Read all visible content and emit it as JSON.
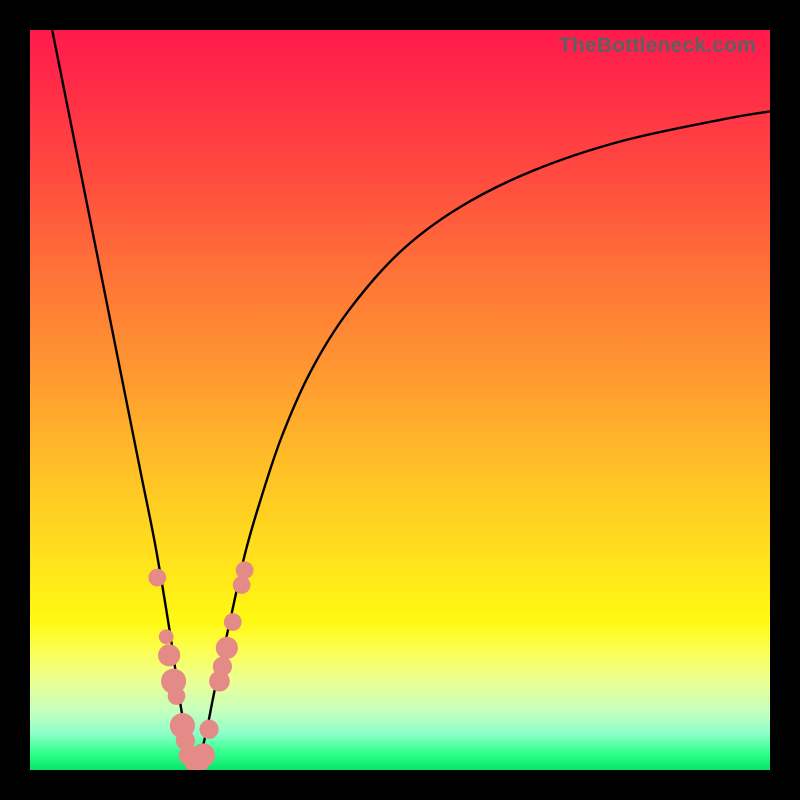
{
  "watermark": "TheBottleneck.com",
  "colors": {
    "frame": "#000000",
    "curve": "#000000",
    "bead": "#e58b87",
    "gradient_top": "#ff1a4d",
    "gradient_bottom": "#07e46a"
  },
  "chart_data": {
    "type": "line",
    "title": "",
    "xlabel": "",
    "ylabel": "",
    "xlim": [
      0,
      100
    ],
    "ylim": [
      0,
      100
    ],
    "note": "No axes/ticks shown; x and y are normalized 0–100 across the plot area. Curve is a V-shaped bottleneck profile with minimum near x≈22.",
    "series": [
      {
        "name": "bottleneck-curve",
        "x": [
          3,
          5,
          7,
          9,
          11,
          13,
          15,
          17,
          19,
          20,
          21,
          22,
          23,
          24,
          25,
          27,
          29,
          31,
          34,
          38,
          43,
          50,
          58,
          68,
          80,
          94,
          100
        ],
        "y": [
          100,
          90,
          80,
          70,
          60,
          50,
          40,
          30,
          18,
          11,
          5,
          1,
          2,
          6,
          11,
          20,
          29,
          36,
          45,
          54,
          62,
          70,
          76,
          81,
          85,
          88,
          89
        ]
      }
    ],
    "beads": {
      "name": "highlight-points",
      "points": [
        {
          "x": 17.2,
          "y": 26.0,
          "r": 1.2
        },
        {
          "x": 18.4,
          "y": 18.0,
          "r": 1.0
        },
        {
          "x": 18.8,
          "y": 15.5,
          "r": 1.5
        },
        {
          "x": 19.4,
          "y": 12.0,
          "r": 1.7
        },
        {
          "x": 19.8,
          "y": 10.0,
          "r": 1.2
        },
        {
          "x": 20.6,
          "y": 6.0,
          "r": 1.7
        },
        {
          "x": 21.0,
          "y": 4.0,
          "r": 1.3
        },
        {
          "x": 21.5,
          "y": 2.0,
          "r": 1.4
        },
        {
          "x": 22.2,
          "y": 1.0,
          "r": 1.3
        },
        {
          "x": 22.8,
          "y": 1.2,
          "r": 1.5
        },
        {
          "x": 23.4,
          "y": 2.0,
          "r": 1.6
        },
        {
          "x": 24.2,
          "y": 5.5,
          "r": 1.3
        },
        {
          "x": 25.6,
          "y": 12.0,
          "r": 1.4
        },
        {
          "x": 26.0,
          "y": 14.0,
          "r": 1.3
        },
        {
          "x": 26.6,
          "y": 16.5,
          "r": 1.5
        },
        {
          "x": 27.4,
          "y": 20.0,
          "r": 1.2
        },
        {
          "x": 28.6,
          "y": 25.0,
          "r": 1.2
        },
        {
          "x": 29.0,
          "y": 27.0,
          "r": 1.2
        }
      ]
    }
  }
}
